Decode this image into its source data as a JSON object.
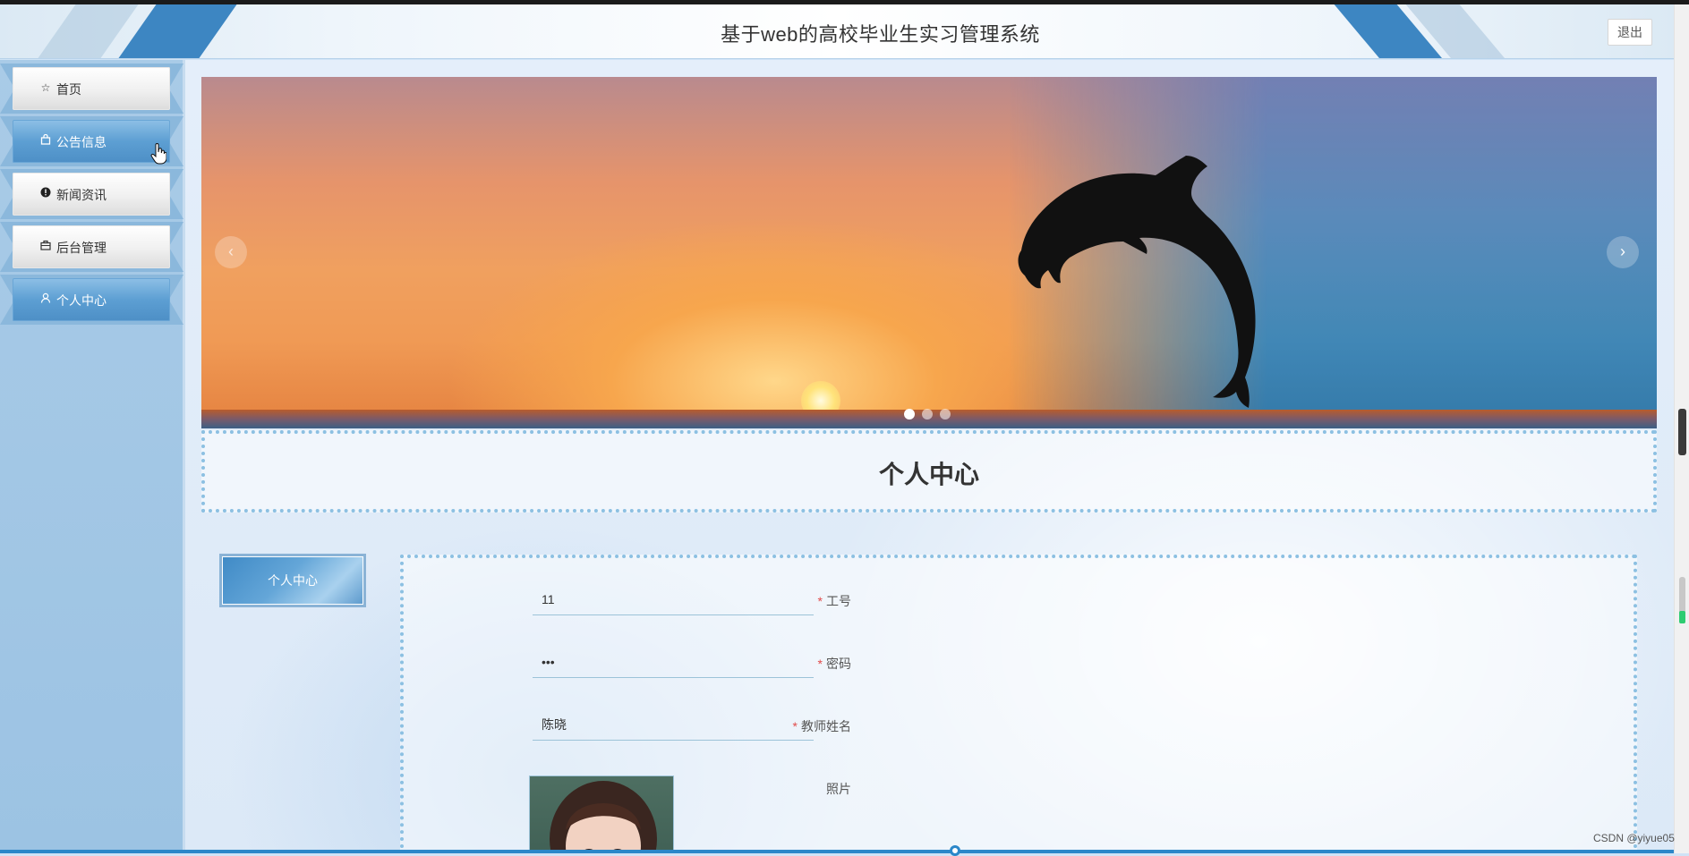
{
  "header": {
    "title": "基于web的高校毕业生实习管理系统",
    "logout_label": "退出"
  },
  "sidebar": {
    "items": [
      {
        "label": "首页",
        "icon": "star-icon"
      },
      {
        "label": "公告信息",
        "icon": "bag-icon"
      },
      {
        "label": "新闻资讯",
        "icon": "info-icon"
      },
      {
        "label": "后台管理",
        "icon": "briefcase-icon"
      },
      {
        "label": "个人中心",
        "icon": "user-icon"
      }
    ]
  },
  "banner": {
    "prev": "‹",
    "next": "›",
    "slide_count": 3,
    "active_slide": 0
  },
  "page": {
    "section_title": "个人中心",
    "side_tab_label": "个人中心"
  },
  "form": {
    "fields": [
      {
        "label": "工号",
        "required": true,
        "value": "11"
      },
      {
        "label": "密码",
        "required": true,
        "value": "•••"
      },
      {
        "label": "教师姓名",
        "required": true,
        "value": "陈晓"
      },
      {
        "label": "照片",
        "required": false,
        "value": ""
      }
    ],
    "required_mark": "*"
  },
  "watermark": "CSDN @yiyue05",
  "colors": {
    "accent": "#3d86c2",
    "sidebar_bg": "#a9cbe7",
    "dotted_border": "#8cc0e2",
    "required": "#e14b4b"
  }
}
